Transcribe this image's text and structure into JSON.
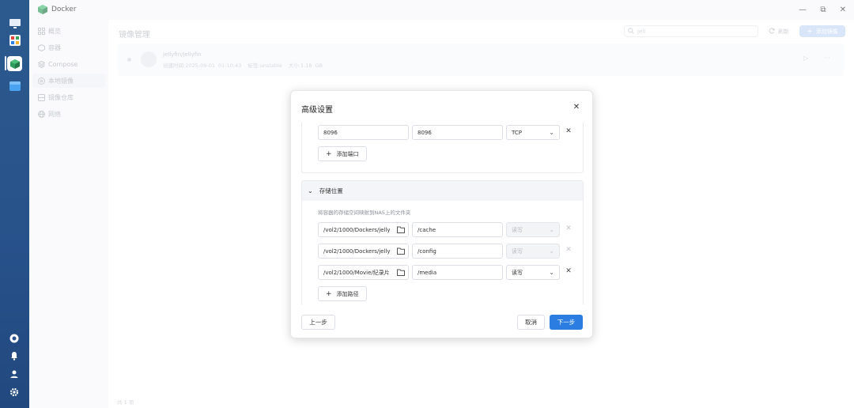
{
  "app": {
    "title": "Docker"
  },
  "window_controls": {
    "minimize": "—",
    "restore": "⧉",
    "close": "✕"
  },
  "sidebar": {
    "items": [
      {
        "label": "概览",
        "icon": "grid-icon"
      },
      {
        "label": "容器",
        "icon": "cube-icon"
      },
      {
        "label": "Compose",
        "icon": "layers-icon"
      },
      {
        "label": "本地镜像",
        "icon": "disc-icon",
        "active": true
      },
      {
        "label": "镜像仓库",
        "icon": "database-icon"
      },
      {
        "label": "网络",
        "icon": "globe-icon"
      }
    ]
  },
  "main": {
    "page_title": "镜像管理",
    "search_value": "jell",
    "refresh_label": "刷新",
    "add_image_label": "添加镜像",
    "image": {
      "name": "jellyfin/jellyfin",
      "created_label": "创建时间:",
      "created_value": "2025-09-01 01:10:43",
      "tag_label": "标签:",
      "tag_value": "unstable",
      "size_label": "大小:",
      "size_value": "1.18 GB"
    },
    "footer_count": "共 1 项"
  },
  "dialog": {
    "title": "高级设置",
    "close": "✕",
    "port_row": {
      "host_port": "8096",
      "container_port": "8096",
      "protocol": "TCP"
    },
    "add_port_label": "添加端口",
    "storage": {
      "title": "存储位置",
      "description": "将容器的存储空间映射到NAS上的文件夹",
      "rows": [
        {
          "host_path": "/vol2/1000/Dockers/jelly",
          "container_path": "/cache",
          "mode": "读写",
          "disabled": true
        },
        {
          "host_path": "/vol2/1000/Dockers/jelly",
          "container_path": "/config",
          "mode": "读写",
          "disabled": true
        },
        {
          "host_path": "/vol2/1000/Movie/纪录片",
          "container_path": "/media",
          "mode": "读写",
          "disabled": false
        }
      ],
      "add_path_label": "添加路径"
    },
    "prev_label": "上一步",
    "cancel_label": "取消",
    "next_label": "下一步"
  },
  "colors": {
    "primary": "#2b7de1",
    "dock": "#27518a"
  }
}
